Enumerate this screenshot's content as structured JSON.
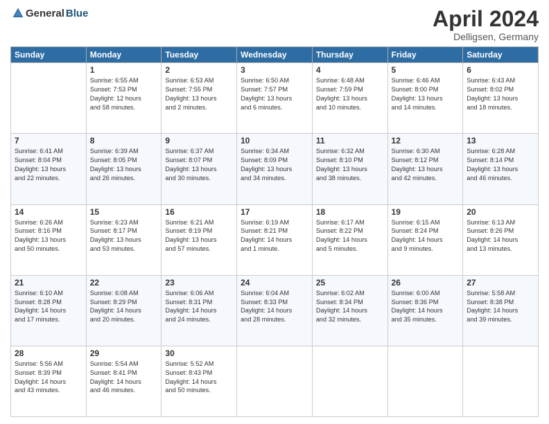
{
  "logo": {
    "general": "General",
    "blue": "Blue"
  },
  "title": {
    "month": "April 2024",
    "location": "Delligsen, Germany"
  },
  "weekdays": [
    "Sunday",
    "Monday",
    "Tuesday",
    "Wednesday",
    "Thursday",
    "Friday",
    "Saturday"
  ],
  "weeks": [
    [
      {
        "day": "",
        "info": ""
      },
      {
        "day": "1",
        "info": "Sunrise: 6:55 AM\nSunset: 7:53 PM\nDaylight: 12 hours\nand 58 minutes."
      },
      {
        "day": "2",
        "info": "Sunrise: 6:53 AM\nSunset: 7:55 PM\nDaylight: 13 hours\nand 2 minutes."
      },
      {
        "day": "3",
        "info": "Sunrise: 6:50 AM\nSunset: 7:57 PM\nDaylight: 13 hours\nand 6 minutes."
      },
      {
        "day": "4",
        "info": "Sunrise: 6:48 AM\nSunset: 7:59 PM\nDaylight: 13 hours\nand 10 minutes."
      },
      {
        "day": "5",
        "info": "Sunrise: 6:46 AM\nSunset: 8:00 PM\nDaylight: 13 hours\nand 14 minutes."
      },
      {
        "day": "6",
        "info": "Sunrise: 6:43 AM\nSunset: 8:02 PM\nDaylight: 13 hours\nand 18 minutes."
      }
    ],
    [
      {
        "day": "7",
        "info": "Sunrise: 6:41 AM\nSunset: 8:04 PM\nDaylight: 13 hours\nand 22 minutes."
      },
      {
        "day": "8",
        "info": "Sunrise: 6:39 AM\nSunset: 8:05 PM\nDaylight: 13 hours\nand 26 minutes."
      },
      {
        "day": "9",
        "info": "Sunrise: 6:37 AM\nSunset: 8:07 PM\nDaylight: 13 hours\nand 30 minutes."
      },
      {
        "day": "10",
        "info": "Sunrise: 6:34 AM\nSunset: 8:09 PM\nDaylight: 13 hours\nand 34 minutes."
      },
      {
        "day": "11",
        "info": "Sunrise: 6:32 AM\nSunset: 8:10 PM\nDaylight: 13 hours\nand 38 minutes."
      },
      {
        "day": "12",
        "info": "Sunrise: 6:30 AM\nSunset: 8:12 PM\nDaylight: 13 hours\nand 42 minutes."
      },
      {
        "day": "13",
        "info": "Sunrise: 6:28 AM\nSunset: 8:14 PM\nDaylight: 13 hours\nand 46 minutes."
      }
    ],
    [
      {
        "day": "14",
        "info": "Sunrise: 6:26 AM\nSunset: 8:16 PM\nDaylight: 13 hours\nand 50 minutes."
      },
      {
        "day": "15",
        "info": "Sunrise: 6:23 AM\nSunset: 8:17 PM\nDaylight: 13 hours\nand 53 minutes."
      },
      {
        "day": "16",
        "info": "Sunrise: 6:21 AM\nSunset: 8:19 PM\nDaylight: 13 hours\nand 57 minutes."
      },
      {
        "day": "17",
        "info": "Sunrise: 6:19 AM\nSunset: 8:21 PM\nDaylight: 14 hours\nand 1 minute."
      },
      {
        "day": "18",
        "info": "Sunrise: 6:17 AM\nSunset: 8:22 PM\nDaylight: 14 hours\nand 5 minutes."
      },
      {
        "day": "19",
        "info": "Sunrise: 6:15 AM\nSunset: 8:24 PM\nDaylight: 14 hours\nand 9 minutes."
      },
      {
        "day": "20",
        "info": "Sunrise: 6:13 AM\nSunset: 8:26 PM\nDaylight: 14 hours\nand 13 minutes."
      }
    ],
    [
      {
        "day": "21",
        "info": "Sunrise: 6:10 AM\nSunset: 8:28 PM\nDaylight: 14 hours\nand 17 minutes."
      },
      {
        "day": "22",
        "info": "Sunrise: 6:08 AM\nSunset: 8:29 PM\nDaylight: 14 hours\nand 20 minutes."
      },
      {
        "day": "23",
        "info": "Sunrise: 6:06 AM\nSunset: 8:31 PM\nDaylight: 14 hours\nand 24 minutes."
      },
      {
        "day": "24",
        "info": "Sunrise: 6:04 AM\nSunset: 8:33 PM\nDaylight: 14 hours\nand 28 minutes."
      },
      {
        "day": "25",
        "info": "Sunrise: 6:02 AM\nSunset: 8:34 PM\nDaylight: 14 hours\nand 32 minutes."
      },
      {
        "day": "26",
        "info": "Sunrise: 6:00 AM\nSunset: 8:36 PM\nDaylight: 14 hours\nand 35 minutes."
      },
      {
        "day": "27",
        "info": "Sunrise: 5:58 AM\nSunset: 8:38 PM\nDaylight: 14 hours\nand 39 minutes."
      }
    ],
    [
      {
        "day": "28",
        "info": "Sunrise: 5:56 AM\nSunset: 8:39 PM\nDaylight: 14 hours\nand 43 minutes."
      },
      {
        "day": "29",
        "info": "Sunrise: 5:54 AM\nSunset: 8:41 PM\nDaylight: 14 hours\nand 46 minutes."
      },
      {
        "day": "30",
        "info": "Sunrise: 5:52 AM\nSunset: 8:43 PM\nDaylight: 14 hours\nand 50 minutes."
      },
      {
        "day": "",
        "info": ""
      },
      {
        "day": "",
        "info": ""
      },
      {
        "day": "",
        "info": ""
      },
      {
        "day": "",
        "info": ""
      }
    ]
  ]
}
